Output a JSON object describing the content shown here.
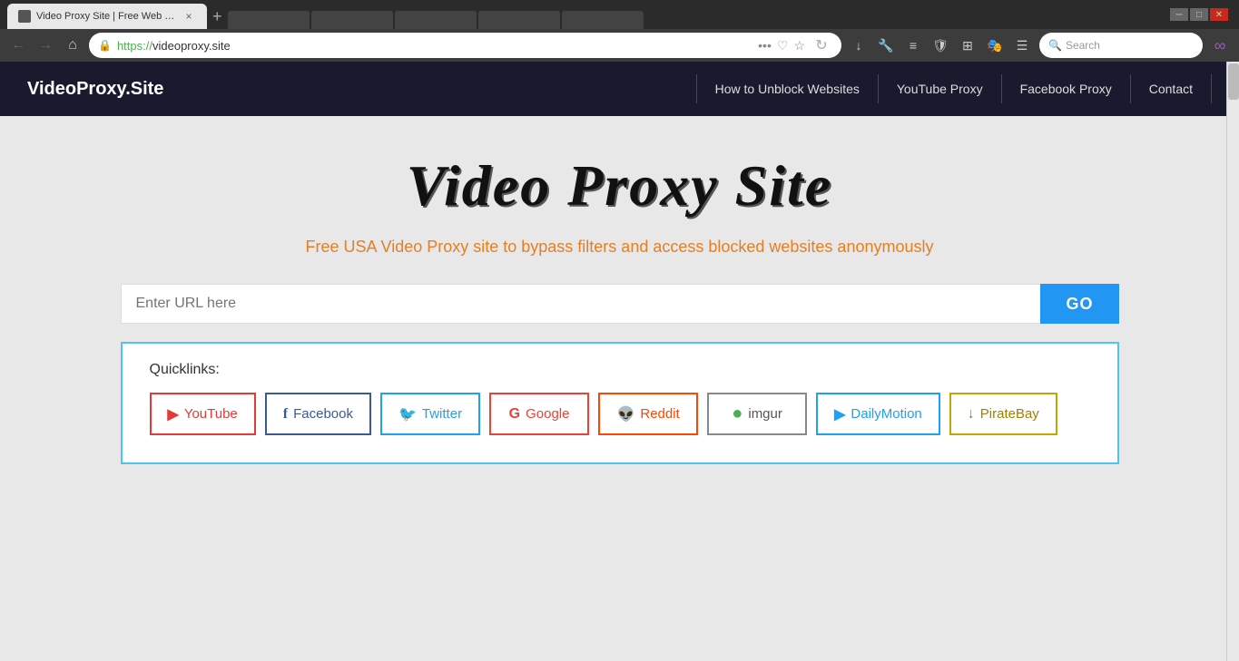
{
  "browser": {
    "tab": {
      "title": "Video Proxy Site | Free Web Proxy t...",
      "close_label": "×"
    },
    "new_tab_label": "+",
    "address": {
      "protocol": "https://",
      "domain": "videoproxy.site"
    },
    "search_placeholder": "Search"
  },
  "navbar": {
    "brand": "VideoProxy.Site",
    "links": [
      {
        "label": "How to Unblock Websites"
      },
      {
        "label": "YouTube Proxy"
      },
      {
        "label": "Facebook Proxy"
      },
      {
        "label": "Contact"
      }
    ]
  },
  "hero": {
    "title": "Video Proxy Site",
    "subtitle": "Free USA Video Proxy site to bypass filters and access blocked websites anonymously",
    "url_placeholder": "Enter URL here",
    "go_label": "GO"
  },
  "quicklinks": {
    "label": "Quicklinks:",
    "buttons": [
      {
        "id": "youtube",
        "icon": "▶",
        "label": "YouTube",
        "class": "ql-youtube"
      },
      {
        "id": "facebook",
        "icon": "f",
        "label": "Facebook",
        "class": "ql-facebook"
      },
      {
        "id": "twitter",
        "icon": "🐦",
        "label": "Twitter",
        "class": "ql-twitter"
      },
      {
        "id": "google",
        "icon": "G",
        "label": "Google",
        "class": "ql-google"
      },
      {
        "id": "reddit",
        "icon": "👽",
        "label": "Reddit",
        "class": "ql-reddit"
      },
      {
        "id": "imgur",
        "icon": "●",
        "label": "imgur",
        "class": "ql-imgur"
      },
      {
        "id": "dailymotion",
        "icon": "▶",
        "label": "DailyMotion",
        "class": "ql-dailymotion"
      },
      {
        "id": "piratebay",
        "icon": "↓",
        "label": "PirateBay",
        "class": "ql-piratebay"
      }
    ]
  }
}
